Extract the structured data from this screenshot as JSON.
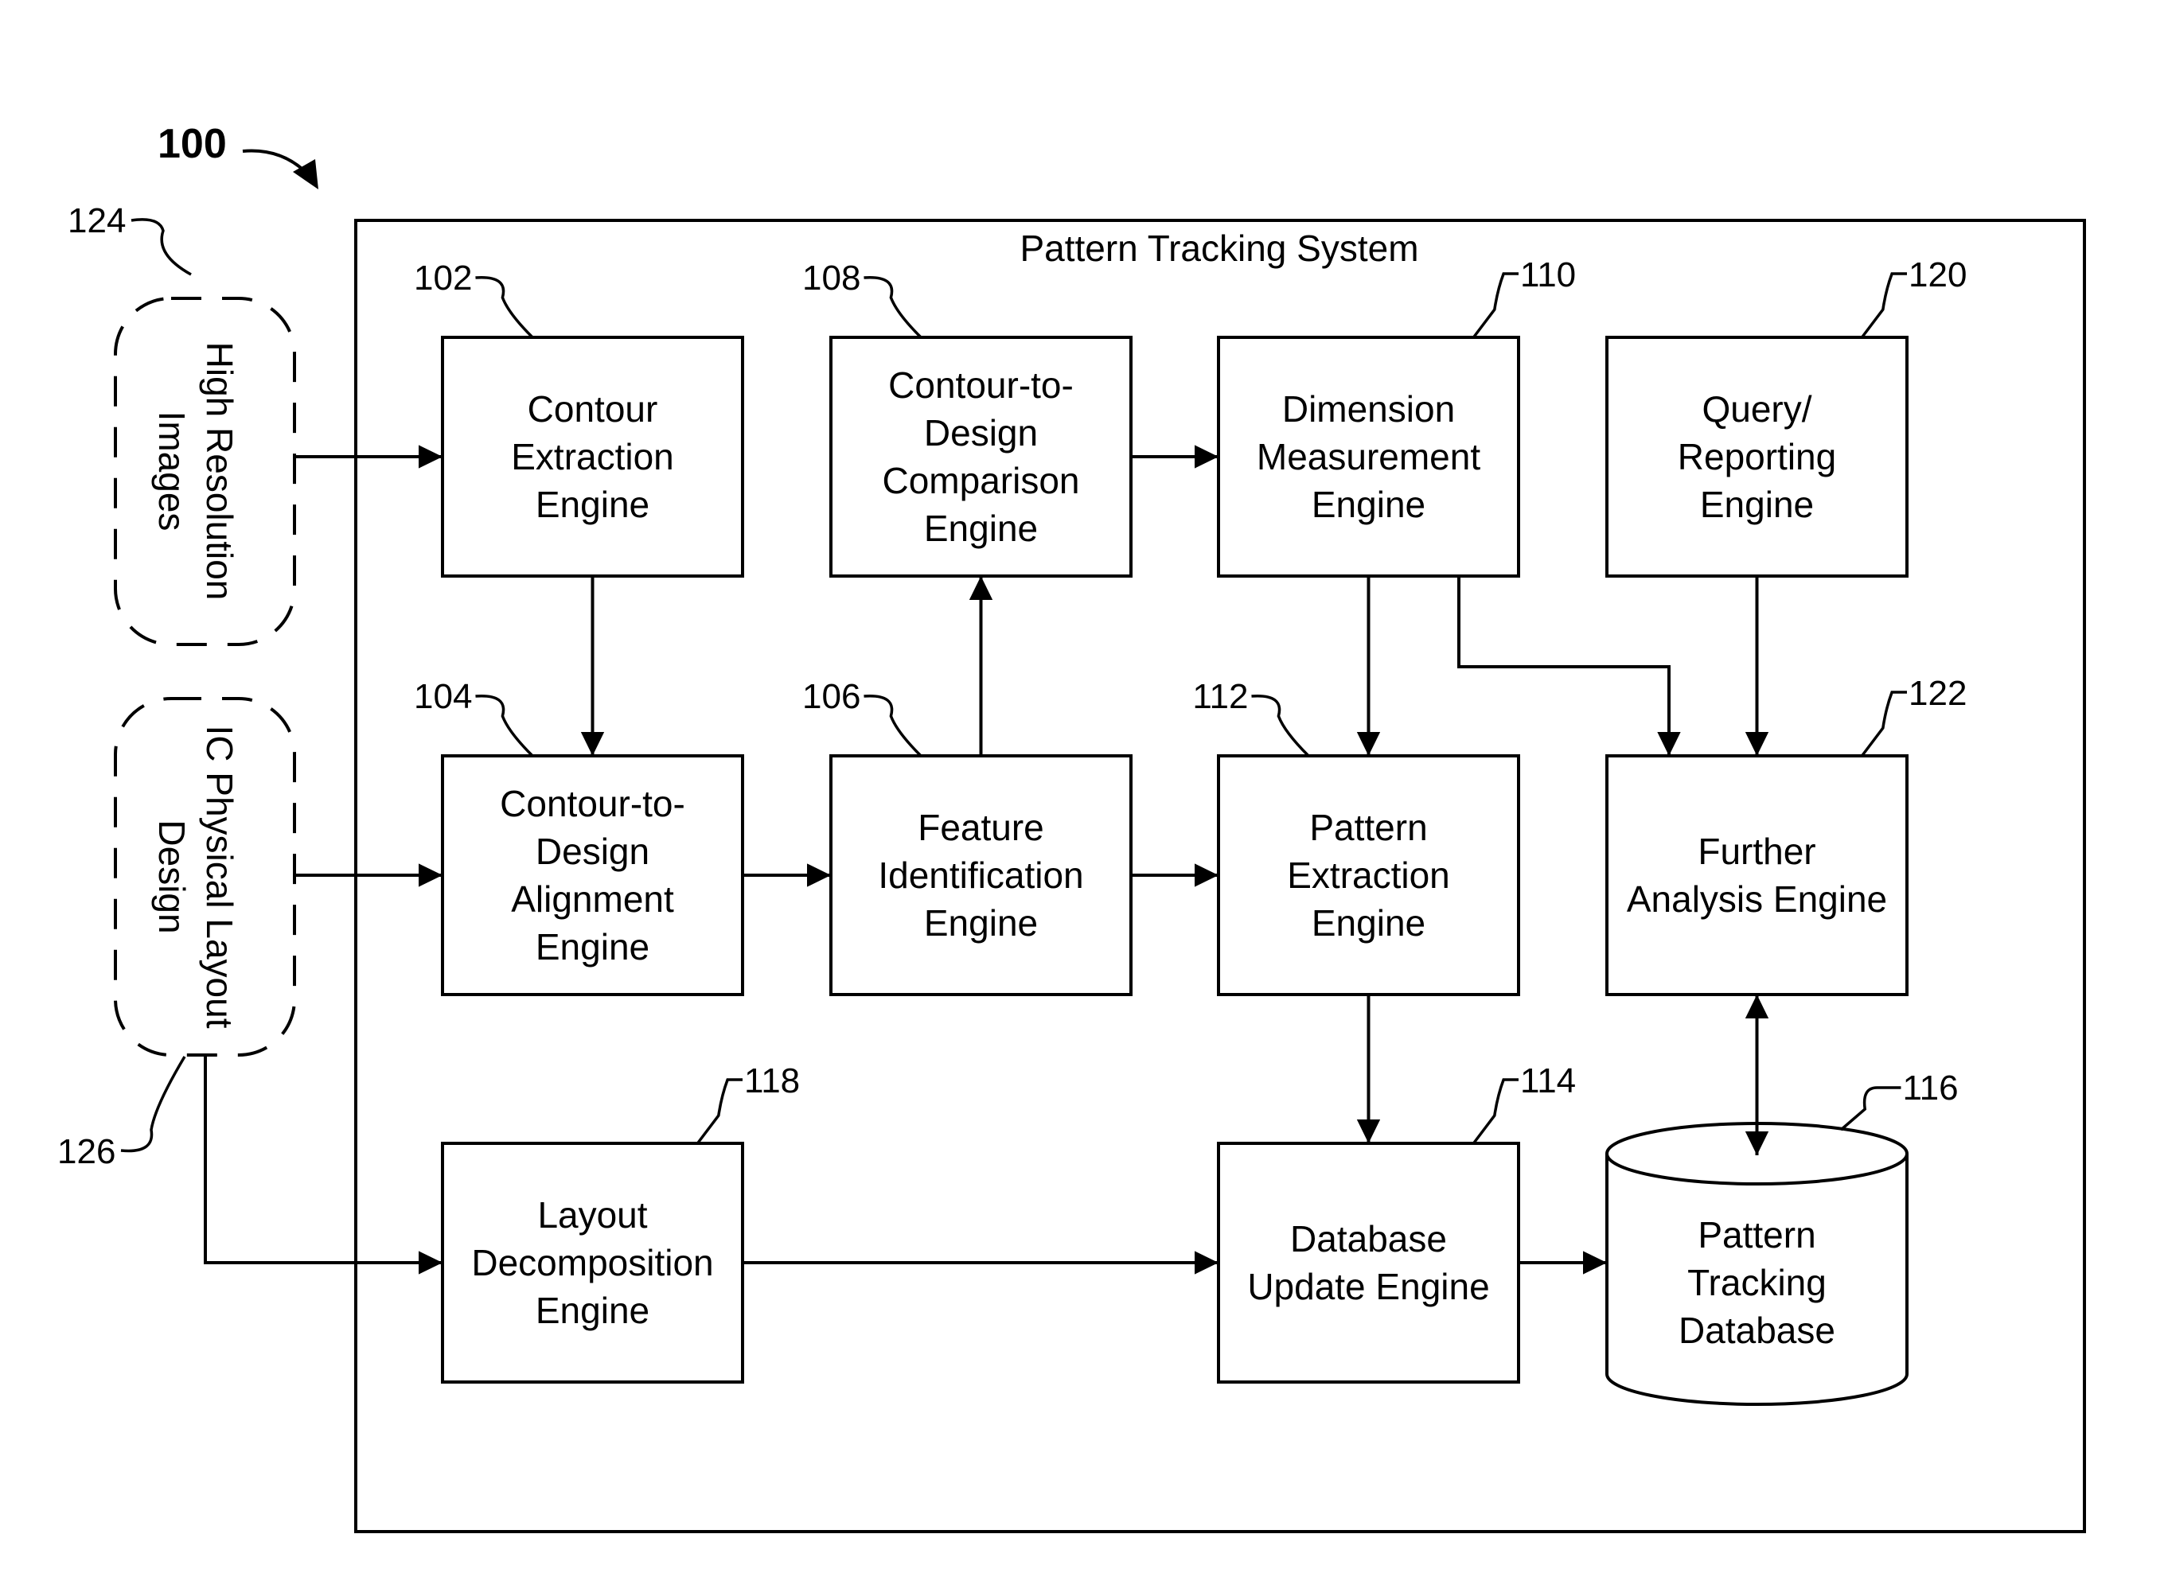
{
  "figure": {
    "ref": "100",
    "system_title": "Pattern Tracking System",
    "system_ref": ""
  },
  "inputs": [
    {
      "id": "in124",
      "ref": "124",
      "lines": [
        "High Resolution",
        "Images"
      ]
    },
    {
      "id": "in126",
      "ref": "126",
      "lines": [
        "IC Physical Layout",
        "Design"
      ]
    }
  ],
  "engines": [
    {
      "id": "e102",
      "ref": "102",
      "lines": [
        "Contour",
        "Extraction",
        "Engine"
      ]
    },
    {
      "id": "e108",
      "ref": "108",
      "lines": [
        "Contour-to-",
        "Design",
        "Comparison",
        "Engine"
      ]
    },
    {
      "id": "e110",
      "ref": "110",
      "lines": [
        "Dimension",
        "Measurement",
        "Engine"
      ]
    },
    {
      "id": "e120",
      "ref": "120",
      "lines": [
        "Query/",
        "Reporting",
        "Engine"
      ]
    },
    {
      "id": "e104",
      "ref": "104",
      "lines": [
        "Contour-to-",
        "Design",
        "Alignment",
        "Engine"
      ]
    },
    {
      "id": "e106",
      "ref": "106",
      "lines": [
        "Feature",
        "Identification",
        "Engine"
      ]
    },
    {
      "id": "e112",
      "ref": "112",
      "lines": [
        "Pattern",
        "Extraction",
        "Engine"
      ]
    },
    {
      "id": "e122",
      "ref": "122",
      "lines": [
        "Further",
        "Analysis Engine"
      ]
    },
    {
      "id": "e118",
      "ref": "118",
      "lines": [
        "Layout",
        "Decomposition",
        "Engine"
      ]
    },
    {
      "id": "e114",
      "ref": "114",
      "lines": [
        "Database",
        "Update Engine"
      ]
    }
  ],
  "database": {
    "id": "db116",
    "ref": "116",
    "lines": [
      "Pattern",
      "Tracking",
      "Database"
    ]
  },
  "connections": [
    {
      "from": "in124",
      "to": "e102",
      "type": "arrow"
    },
    {
      "from": "in126",
      "to": "e104",
      "type": "arrow"
    },
    {
      "from": "in126",
      "to": "e118",
      "type": "arrow"
    },
    {
      "from": "e102",
      "to": "e104",
      "type": "arrow"
    },
    {
      "from": "e104",
      "to": "e106",
      "type": "arrow"
    },
    {
      "from": "e106",
      "to": "e108",
      "type": "arrow"
    },
    {
      "from": "e108",
      "to": "e110",
      "type": "arrow"
    },
    {
      "from": "e106",
      "to": "e112",
      "type": "arrow"
    },
    {
      "from": "e110",
      "to": "e112",
      "type": "arrow"
    },
    {
      "from": "e110",
      "to": "e122",
      "type": "arrow"
    },
    {
      "from": "e120",
      "to": "e122",
      "type": "arrow"
    },
    {
      "from": "e112",
      "to": "e114",
      "type": "arrow"
    },
    {
      "from": "e118",
      "to": "e114",
      "type": "arrow"
    },
    {
      "from": "e114",
      "to": "db116",
      "type": "arrow"
    },
    {
      "from": "e122",
      "to": "db116",
      "type": "bidirectional"
    }
  ]
}
